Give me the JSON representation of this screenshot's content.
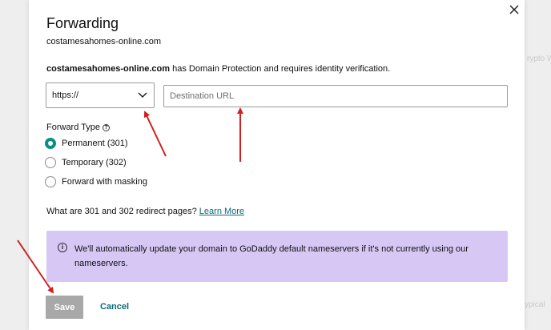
{
  "background": {
    "right_text_top": "rypto W",
    "right_text_bottom": "ypical"
  },
  "dialog": {
    "title": "Forwarding",
    "domain": "costamesahomes-online.com",
    "notice_domain": "costamesahomes-online.com",
    "notice_text": " has Domain Protection and requires identity verification.",
    "close_icon": "close-icon"
  },
  "form": {
    "protocol_value": "https://",
    "destination_placeholder": "Destination URL",
    "forward_type_label": "Forward Type",
    "forward_type_info_glyph": "?",
    "options": [
      {
        "label": "Permanent (301)",
        "checked": true
      },
      {
        "label": "Temporary (302)",
        "checked": false
      },
      {
        "label": "Forward with masking",
        "checked": false
      }
    ],
    "faq_text": "What are 301 and 302 redirect pages? ",
    "faq_link": "Learn More"
  },
  "banner": {
    "icon": "info-icon",
    "text": "We'll automatically update your domain to GoDaddy default nameservers if it's not currently using our nameservers."
  },
  "actions": {
    "save_label": "Save",
    "cancel_label": "Cancel"
  },
  "colors": {
    "accent_teal": "#0a8f86",
    "link": "#0a6a7a",
    "banner_bg": "#d6c7f5",
    "annotation_arrow": "#d0201f",
    "save_disabled": "#a8a8a8"
  }
}
